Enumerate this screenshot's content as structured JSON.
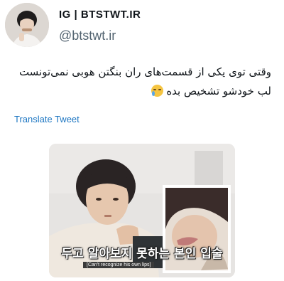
{
  "account": {
    "display_name": "IG | BTSTWT.IR",
    "handle": "@btstwt.ir"
  },
  "tweet": {
    "lines": [
      "وقتی توی یکی از قسمت‌های ران بنگتن هوبی نمی‌تونست",
      "لب خودشو تشخیص بده"
    ],
    "emoji": "loudly-crying-face"
  },
  "translate_label": "Translate Tweet",
  "media": {
    "caption_korean": "두고 알아보지 못하는 본인 입술",
    "caption_english": "[Can't recognize his own lips]"
  },
  "colors": {
    "link": "#1d76c2",
    "handle": "#536471",
    "text": "#0f1419"
  }
}
